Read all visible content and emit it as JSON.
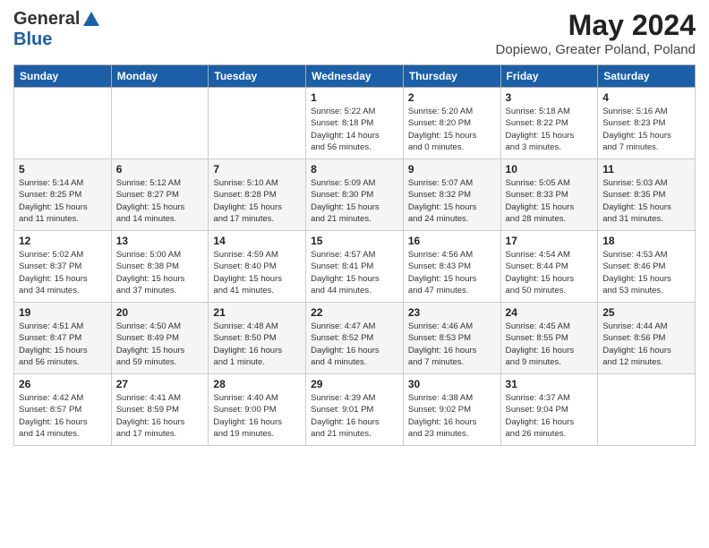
{
  "header": {
    "logo_general": "General",
    "logo_blue": "Blue",
    "title": "May 2024",
    "subtitle": "Dopiewo, Greater Poland, Poland"
  },
  "weekdays": [
    "Sunday",
    "Monday",
    "Tuesday",
    "Wednesday",
    "Thursday",
    "Friday",
    "Saturday"
  ],
  "weeks": [
    [
      {
        "day": "",
        "info": ""
      },
      {
        "day": "",
        "info": ""
      },
      {
        "day": "",
        "info": ""
      },
      {
        "day": "1",
        "info": "Sunrise: 5:22 AM\nSunset: 8:18 PM\nDaylight: 14 hours\nand 56 minutes."
      },
      {
        "day": "2",
        "info": "Sunrise: 5:20 AM\nSunset: 8:20 PM\nDaylight: 15 hours\nand 0 minutes."
      },
      {
        "day": "3",
        "info": "Sunrise: 5:18 AM\nSunset: 8:22 PM\nDaylight: 15 hours\nand 3 minutes."
      },
      {
        "day": "4",
        "info": "Sunrise: 5:16 AM\nSunset: 8:23 PM\nDaylight: 15 hours\nand 7 minutes."
      }
    ],
    [
      {
        "day": "5",
        "info": "Sunrise: 5:14 AM\nSunset: 8:25 PM\nDaylight: 15 hours\nand 11 minutes."
      },
      {
        "day": "6",
        "info": "Sunrise: 5:12 AM\nSunset: 8:27 PM\nDaylight: 15 hours\nand 14 minutes."
      },
      {
        "day": "7",
        "info": "Sunrise: 5:10 AM\nSunset: 8:28 PM\nDaylight: 15 hours\nand 17 minutes."
      },
      {
        "day": "8",
        "info": "Sunrise: 5:09 AM\nSunset: 8:30 PM\nDaylight: 15 hours\nand 21 minutes."
      },
      {
        "day": "9",
        "info": "Sunrise: 5:07 AM\nSunset: 8:32 PM\nDaylight: 15 hours\nand 24 minutes."
      },
      {
        "day": "10",
        "info": "Sunrise: 5:05 AM\nSunset: 8:33 PM\nDaylight: 15 hours\nand 28 minutes."
      },
      {
        "day": "11",
        "info": "Sunrise: 5:03 AM\nSunset: 8:35 PM\nDaylight: 15 hours\nand 31 minutes."
      }
    ],
    [
      {
        "day": "12",
        "info": "Sunrise: 5:02 AM\nSunset: 8:37 PM\nDaylight: 15 hours\nand 34 minutes."
      },
      {
        "day": "13",
        "info": "Sunrise: 5:00 AM\nSunset: 8:38 PM\nDaylight: 15 hours\nand 37 minutes."
      },
      {
        "day": "14",
        "info": "Sunrise: 4:59 AM\nSunset: 8:40 PM\nDaylight: 15 hours\nand 41 minutes."
      },
      {
        "day": "15",
        "info": "Sunrise: 4:57 AM\nSunset: 8:41 PM\nDaylight: 15 hours\nand 44 minutes."
      },
      {
        "day": "16",
        "info": "Sunrise: 4:56 AM\nSunset: 8:43 PM\nDaylight: 15 hours\nand 47 minutes."
      },
      {
        "day": "17",
        "info": "Sunrise: 4:54 AM\nSunset: 8:44 PM\nDaylight: 15 hours\nand 50 minutes."
      },
      {
        "day": "18",
        "info": "Sunrise: 4:53 AM\nSunset: 8:46 PM\nDaylight: 15 hours\nand 53 minutes."
      }
    ],
    [
      {
        "day": "19",
        "info": "Sunrise: 4:51 AM\nSunset: 8:47 PM\nDaylight: 15 hours\nand 56 minutes."
      },
      {
        "day": "20",
        "info": "Sunrise: 4:50 AM\nSunset: 8:49 PM\nDaylight: 15 hours\nand 59 minutes."
      },
      {
        "day": "21",
        "info": "Sunrise: 4:48 AM\nSunset: 8:50 PM\nDaylight: 16 hours\nand 1 minute."
      },
      {
        "day": "22",
        "info": "Sunrise: 4:47 AM\nSunset: 8:52 PM\nDaylight: 16 hours\nand 4 minutes."
      },
      {
        "day": "23",
        "info": "Sunrise: 4:46 AM\nSunset: 8:53 PM\nDaylight: 16 hours\nand 7 minutes."
      },
      {
        "day": "24",
        "info": "Sunrise: 4:45 AM\nSunset: 8:55 PM\nDaylight: 16 hours\nand 9 minutes."
      },
      {
        "day": "25",
        "info": "Sunrise: 4:44 AM\nSunset: 8:56 PM\nDaylight: 16 hours\nand 12 minutes."
      }
    ],
    [
      {
        "day": "26",
        "info": "Sunrise: 4:42 AM\nSunset: 8:57 PM\nDaylight: 16 hours\nand 14 minutes."
      },
      {
        "day": "27",
        "info": "Sunrise: 4:41 AM\nSunset: 8:59 PM\nDaylight: 16 hours\nand 17 minutes."
      },
      {
        "day": "28",
        "info": "Sunrise: 4:40 AM\nSunset: 9:00 PM\nDaylight: 16 hours\nand 19 minutes."
      },
      {
        "day": "29",
        "info": "Sunrise: 4:39 AM\nSunset: 9:01 PM\nDaylight: 16 hours\nand 21 minutes."
      },
      {
        "day": "30",
        "info": "Sunrise: 4:38 AM\nSunset: 9:02 PM\nDaylight: 16 hours\nand 23 minutes."
      },
      {
        "day": "31",
        "info": "Sunrise: 4:37 AM\nSunset: 9:04 PM\nDaylight: 16 hours\nand 26 minutes."
      },
      {
        "day": "",
        "info": ""
      }
    ]
  ]
}
